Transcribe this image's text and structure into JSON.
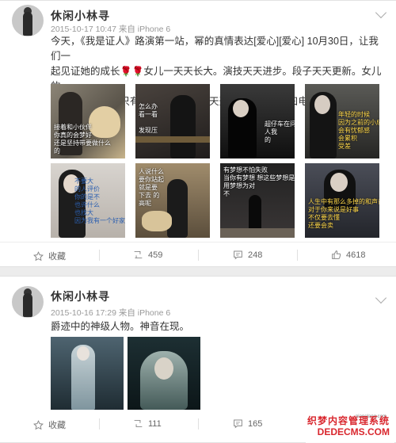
{
  "post1": {
    "username": "休闲小林寻",
    "meta": "2015-10-17 10:47 来自 iPhone 6",
    "text_line1": "今天，《我是证人》路演第一站，幂的真情表达[爱心][爱心] 10月30日，让我们一",
    "text_line2a": "起见证她的成长",
    "text_line2b": "女儿一天天长大。演技天天进步。段子天天更新。女儿的",
    "text_line3": "女儿健康成长。只有这样我才可以天天开心。十月三十曰电影院见。",
    "rose": "🌹",
    "photos": [
      {
        "caption": "接着和小伙伴\n你真的会梦好\n还是坚持带要做什么\n的",
        "tone": "#6b6458"
      },
      {
        "caption": "怎么办\n看一看\n\n发现压",
        "tone": "#3a3532"
      },
      {
        "caption": "超仔车在问\n人我\n的",
        "tone": "#2b2b2b"
      },
      {
        "caption": "年轻的时候\n因为之前的小成就\n会有忧郁感\n会累积\n受差",
        "tone": "#4a4a46"
      },
      {
        "caption": "不要大\n的人评价\n你的是不\n也许什么\n也找大\n因为我有一个好家庭",
        "tone": "#c7c2bc"
      },
      {
        "caption": "人说什么\n要你站起\n就是要\n下去 的\n高呢",
        "tone": "#8c7c62"
      },
      {
        "caption": "有梦想不怕失败\n当你有梦想 想这些梦想是什么?\n用梦想为对\n不",
        "tone": "#2d2a2a"
      },
      {
        "caption": "人生中有那么多掉的和声音\n对于你来说是好事\n不仅要去懂\n还要会卖",
        "tone": "#3b3d44"
      }
    ],
    "actions": {
      "collect": "收藏",
      "repost": "459",
      "comment": "248",
      "like": "4618"
    }
  },
  "post2": {
    "username": "休闲小林寻",
    "meta": "2015-10-16 17:29 来自 iPhone 6",
    "text": "爵迹中的神级人物。神音在现。",
    "actions": {
      "collect": "收藏",
      "repost": "111",
      "comment": "165"
    }
  },
  "watermark": {
    "line1": "织梦内容管理系统",
    "line2": "DEDECMS.COM",
    "small": "pianolang.com"
  }
}
